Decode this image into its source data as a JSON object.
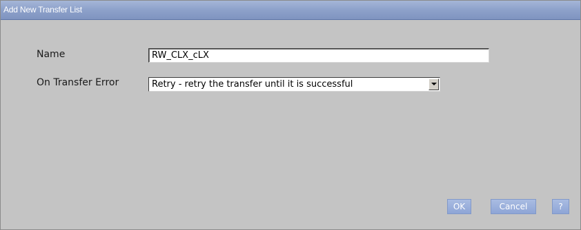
{
  "dialog": {
    "title": "Add New Transfer List"
  },
  "form": {
    "name_label": "Name",
    "name_value": "RW_CLX_cLX",
    "error_label": "On Transfer Error",
    "error_selected": "Retry - retry the transfer until it is successful"
  },
  "buttons": {
    "ok_label": "OK",
    "cancel_label": "Cancel",
    "help_label": "?"
  },
  "colors": {
    "titlebar": "#8da1ca",
    "dialog_background": "#c4c4c4",
    "button": "#9cb1dc"
  }
}
